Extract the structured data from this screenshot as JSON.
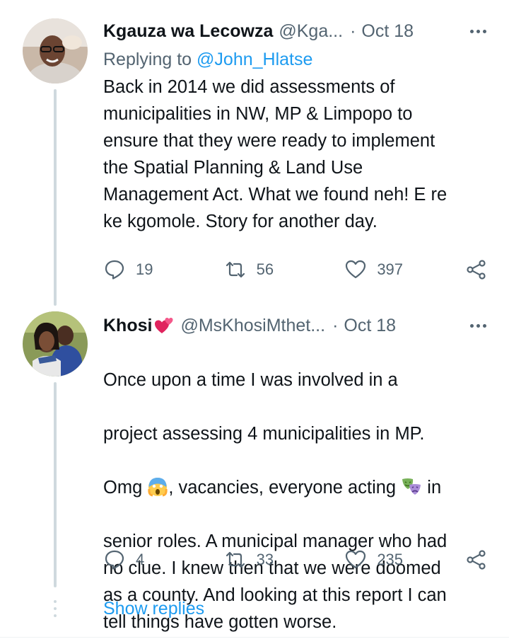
{
  "tweets": [
    {
      "author_name": "Kgauza wa Lecowza",
      "author_handle": "@Kga...",
      "separator": "·",
      "date": "Oct 18",
      "replying_prefix": "Replying to ",
      "replying_handle": "@John_Hlatse",
      "text": "Back in 2014 we did assessments of\nmunicipalities in NW, MP & Limpopo to\nensure that they were ready to implement\nthe Spatial Planning & Land Use\nManagement Act. What we found neh! E re\nke kgomole. Story for another day.",
      "replies": "19",
      "retweets": "56",
      "likes": "397"
    },
    {
      "author_name": "Khosi",
      "author_emoji": "two-hearts-icon",
      "author_handle": "@MsKhosiMthet...",
      "separator": "·",
      "date": "Oct 18",
      "text_line1": "Once upon a time I was involved in a",
      "text_line2": "project assessing 4 municipalities in MP.",
      "text_line3a": "Omg ",
      "text_line3b": ", vacancies, everyone acting ",
      "text_line3c": " in",
      "text_rest": "senior roles. A municipal manager who had\nno clue. I knew then that we were doomed\nas a county. And looking at this report I can\ntell things have gotten worse.",
      "replies": "4",
      "retweets": "33",
      "likes": "235"
    }
  ],
  "show_replies_label": "Show replies",
  "colors": {
    "link": "#1d9bf0",
    "secondary_text": "#536471",
    "primary_text": "#0f1419",
    "thread_line": "#cfd9de"
  }
}
